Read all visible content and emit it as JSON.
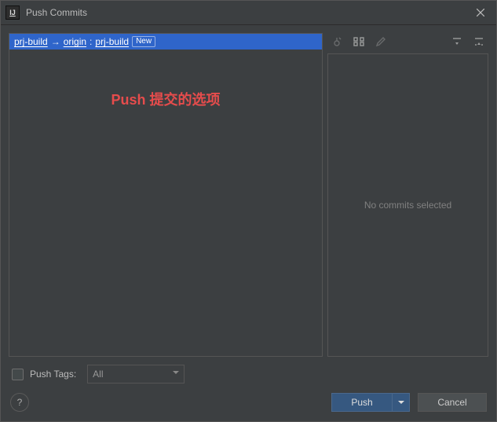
{
  "title": "Push Commits",
  "app_icon_text": "IJ",
  "branch": {
    "local": "prj-build",
    "arrow": "→",
    "remote": "origin",
    "colon": ":",
    "remote_branch": "prj-build",
    "new_badge": "New"
  },
  "annotation": "Push 提交的选项",
  "right_panel": {
    "empty_text": "No commits selected"
  },
  "footer": {
    "push_tags_label": "Push Tags:",
    "push_tags_value": "All",
    "help_label": "?",
    "push_button": "Push",
    "cancel_button": "Cancel"
  }
}
